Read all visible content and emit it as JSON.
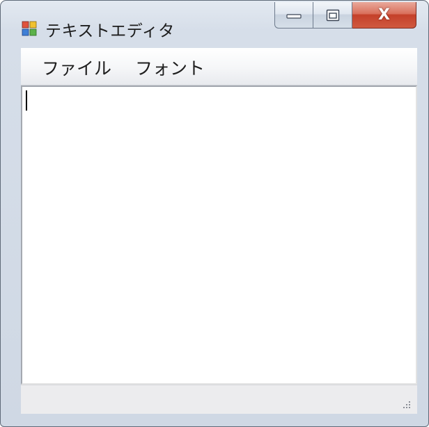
{
  "window": {
    "title": "テキストエディタ"
  },
  "titlebar": {
    "app_icon": "windows-form-icon",
    "minimize_icon": "minimize-icon",
    "maximize_icon": "maximize-icon",
    "close_icon": "close-icon",
    "close_glyph": "X"
  },
  "menu": {
    "items": [
      {
        "label": "ファイル"
      },
      {
        "label": "フォント"
      }
    ]
  },
  "editor": {
    "value": ""
  },
  "statusbar": {
    "grip_icon": "resize-grip-icon"
  },
  "colors": {
    "close_button": "#c4402a",
    "frame": "#cfd8e4"
  }
}
